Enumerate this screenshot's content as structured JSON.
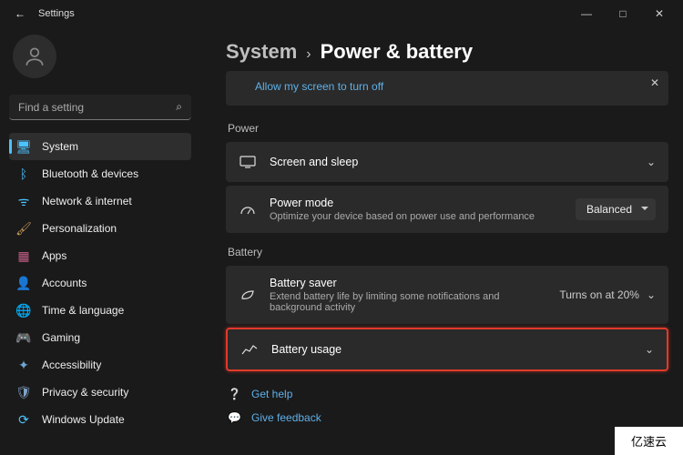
{
  "app_title": "Settings",
  "window_controls": {
    "min": "—",
    "max": "□",
    "close": "✕"
  },
  "search": {
    "placeholder": "Find a setting"
  },
  "sidebar": {
    "items": [
      {
        "label": "System",
        "icon": "🖥"
      },
      {
        "label": "Bluetooth & devices",
        "icon": "ᛒ"
      },
      {
        "label": "Network & internet",
        "icon": "ᯤ"
      },
      {
        "label": "Personalization",
        "icon": "🖌"
      },
      {
        "label": "Apps",
        "icon": "▦"
      },
      {
        "label": "Accounts",
        "icon": "👤"
      },
      {
        "label": "Time & language",
        "icon": "🌐"
      },
      {
        "label": "Gaming",
        "icon": "🎮"
      },
      {
        "label": "Accessibility",
        "icon": "✦"
      },
      {
        "label": "Privacy & security",
        "icon": "🛡"
      },
      {
        "label": "Windows Update",
        "icon": "⟳"
      }
    ]
  },
  "breadcrumb": {
    "parent": "System",
    "sep": "›",
    "current": "Power & battery"
  },
  "banner": {
    "link": "Allow my screen to turn off",
    "close": "✕"
  },
  "sections": {
    "power": {
      "title": "Power",
      "screen_sleep": {
        "title": "Screen and sleep"
      },
      "power_mode": {
        "title": "Power mode",
        "sub": "Optimize your device based on power use and performance",
        "value": "Balanced"
      }
    },
    "battery": {
      "title": "Battery",
      "saver": {
        "title": "Battery saver",
        "sub": "Extend battery life by limiting some notifications and background activity",
        "status": "Turns on at 20%"
      },
      "usage": {
        "title": "Battery usage"
      }
    }
  },
  "links": {
    "help": "Get help",
    "feedback": "Give feedback"
  },
  "watermark": "亿速云"
}
